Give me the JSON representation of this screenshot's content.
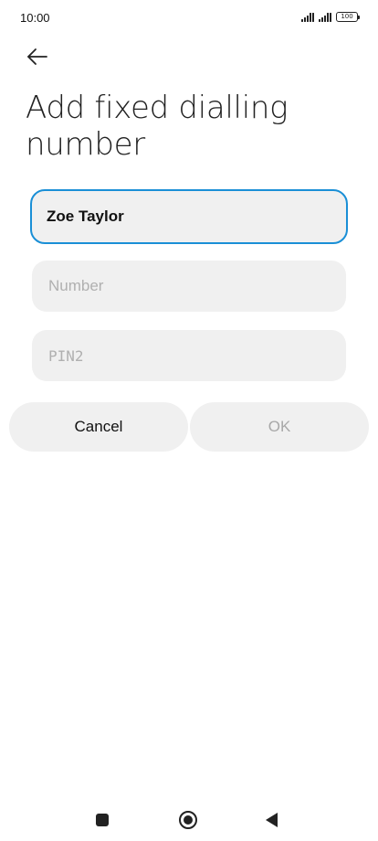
{
  "status_bar": {
    "time": "10:00",
    "battery": "100"
  },
  "header": {
    "back_icon": "arrow-left-icon",
    "title": "Add fixed dialling number"
  },
  "form": {
    "name_value": "Zoe Taylor",
    "number_placeholder": "Number",
    "number_value": "",
    "pin2_placeholder": "PIN2",
    "pin2_value": ""
  },
  "actions": {
    "cancel_label": "Cancel",
    "ok_label": "OK"
  },
  "nav_bar": {
    "icons": [
      "square-icon",
      "circle-home-icon",
      "triangle-back-icon"
    ]
  },
  "colors": {
    "accent": "#1a8fd6",
    "field_bg": "#f0f0f0",
    "disabled_text": "#a8a8a8"
  }
}
